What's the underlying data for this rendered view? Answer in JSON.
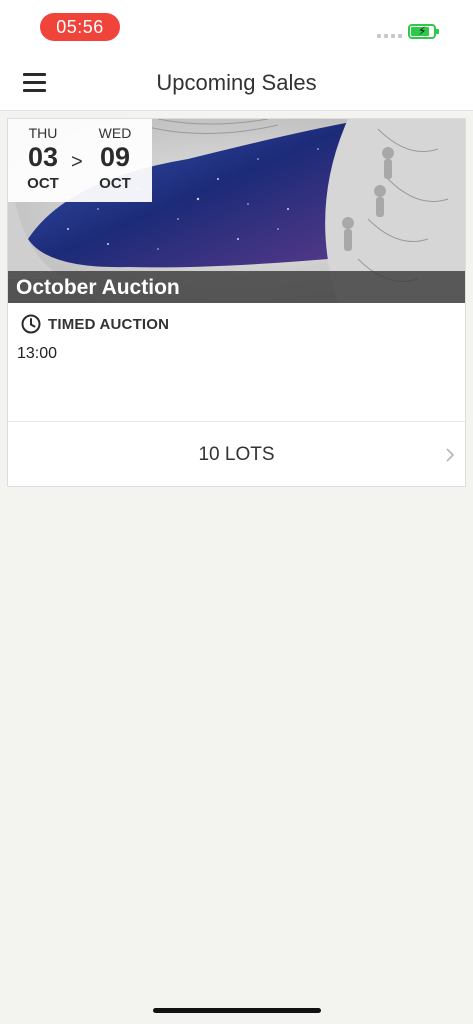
{
  "status_bar": {
    "time": "05:56"
  },
  "nav": {
    "title": "Upcoming Sales"
  },
  "sale": {
    "start": {
      "dow": "THU",
      "day": "03",
      "month": "OCT"
    },
    "separator": ">",
    "end": {
      "dow": "WED",
      "day": "09",
      "month": "OCT"
    },
    "title": "October Auction",
    "type": "TIMED AUCTION",
    "time": "13:00",
    "lots": "10 LOTS"
  },
  "colors": {
    "time_pill": "#f0443b",
    "battery": "#2ec84a",
    "background": "#f3f3ef"
  },
  "icons": {
    "menu": "hamburger-menu-icon",
    "clock": "clock-icon",
    "chevron": "chevron-right-icon"
  }
}
